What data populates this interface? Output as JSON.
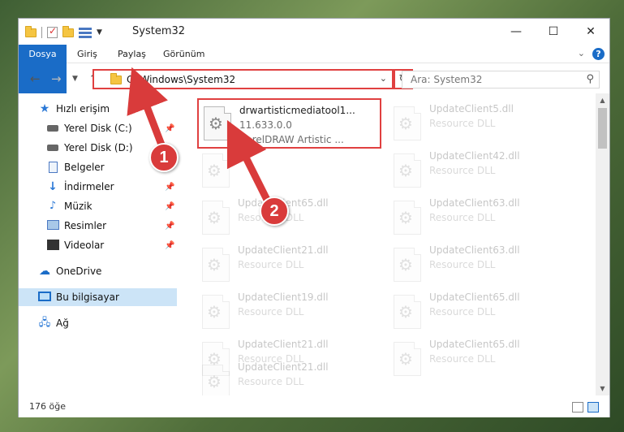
{
  "window": {
    "title": "System32",
    "minimize": "—",
    "maximize": "☐",
    "close": "✕"
  },
  "ribbon": {
    "tabs": [
      "Dosya",
      "Giriş",
      "Paylaş",
      "Görünüm"
    ]
  },
  "address": {
    "path": "C:\\Windows\\System32",
    "search_placeholder": "Ara: System32"
  },
  "nav": {
    "quick_access": "Hızlı erişim",
    "items": [
      "Yerel Disk (C:)",
      "Yerel Disk (D:)",
      "Belgeler",
      "İndirmeler",
      "Müzik",
      "Resimler",
      "Videolar"
    ],
    "onedrive": "OneDrive",
    "this_pc": "Bu bilgisayar",
    "network": "Ağ"
  },
  "files": {
    "highlighted": {
      "name": "drwartisticmediatool1...",
      "version": "11.633.0.0",
      "description": "CorelDRAW Artistic ..."
    },
    "left_col": [
      {
        "name": "",
        "desc": ""
      },
      {
        "name": "UpdateClient65.dll",
        "desc": "Resource DLL"
      },
      {
        "name": "UpdateClient21.dll",
        "desc": "Resource DLL"
      },
      {
        "name": "UpdateClient19.dll",
        "desc": "Resource DLL"
      },
      {
        "name": "UpdateClient21.dll",
        "desc": "Resource DLL"
      },
      {
        "name": "UpdateClient21.dll",
        "desc": "Resource DLL"
      }
    ],
    "right_col": [
      {
        "name": "UpdateClient5.dll",
        "desc": "Resource DLL"
      },
      {
        "name": "UpdateClient42.dll",
        "desc": "Resource DLL"
      },
      {
        "name": "UpdateClient63.dll",
        "desc": "Resource DLL"
      },
      {
        "name": "UpdateClient63.dll",
        "desc": "Resource DLL"
      },
      {
        "name": "UpdateClient65.dll",
        "desc": "Resource DLL"
      },
      {
        "name": "UpdateClient65.dll",
        "desc": "Resource DLL"
      }
    ]
  },
  "status": {
    "count": "176 öğe"
  },
  "annotations": {
    "step1": "1",
    "step2": "2"
  },
  "colors": {
    "accent": "#1a6cc7",
    "highlight": "#e04040",
    "selection": "#cce4f7"
  }
}
